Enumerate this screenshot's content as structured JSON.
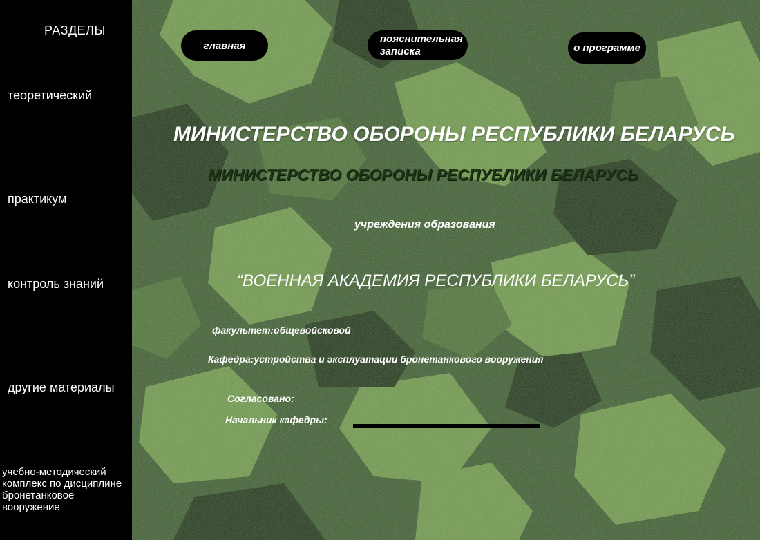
{
  "sidebar": {
    "heading": "РАЗДЕЛЫ",
    "items": [
      {
        "label": "теоретический"
      },
      {
        "label": "практикум"
      },
      {
        "label": "контроль знаний"
      },
      {
        "label": "другие материалы"
      },
      {
        "label": "учебно-методический комплекс по дисциплине бронетанковое вооружение"
      }
    ]
  },
  "nav": {
    "home": "главная",
    "note_line1": "пояснительная",
    "note_line2": "записка",
    "about": "о программе"
  },
  "content": {
    "ministry": "МИНИСТЕРСТВО ОБОРОНЫ РЕСПУБЛИКИ БЕЛАРУСЬ",
    "ministry_shadow": "МИНИСТЕРСТВО ОБОРОНЫ РЕСПУБЛИКИ БЕЛАРУСЬ",
    "institution": "учреждения образования",
    "academy": "“ВОЕННАЯ АКАДЕМИЯ РЕСПУБЛИКИ БЕЛАРУСЬ”",
    "faculty": "факультет:общевойсковой",
    "department": "Кафедра:устройства и эксплуатации бронетанкового вооружения",
    "agreed": "Согласовано:",
    "head_of_department": "Начальник кафедры:"
  }
}
